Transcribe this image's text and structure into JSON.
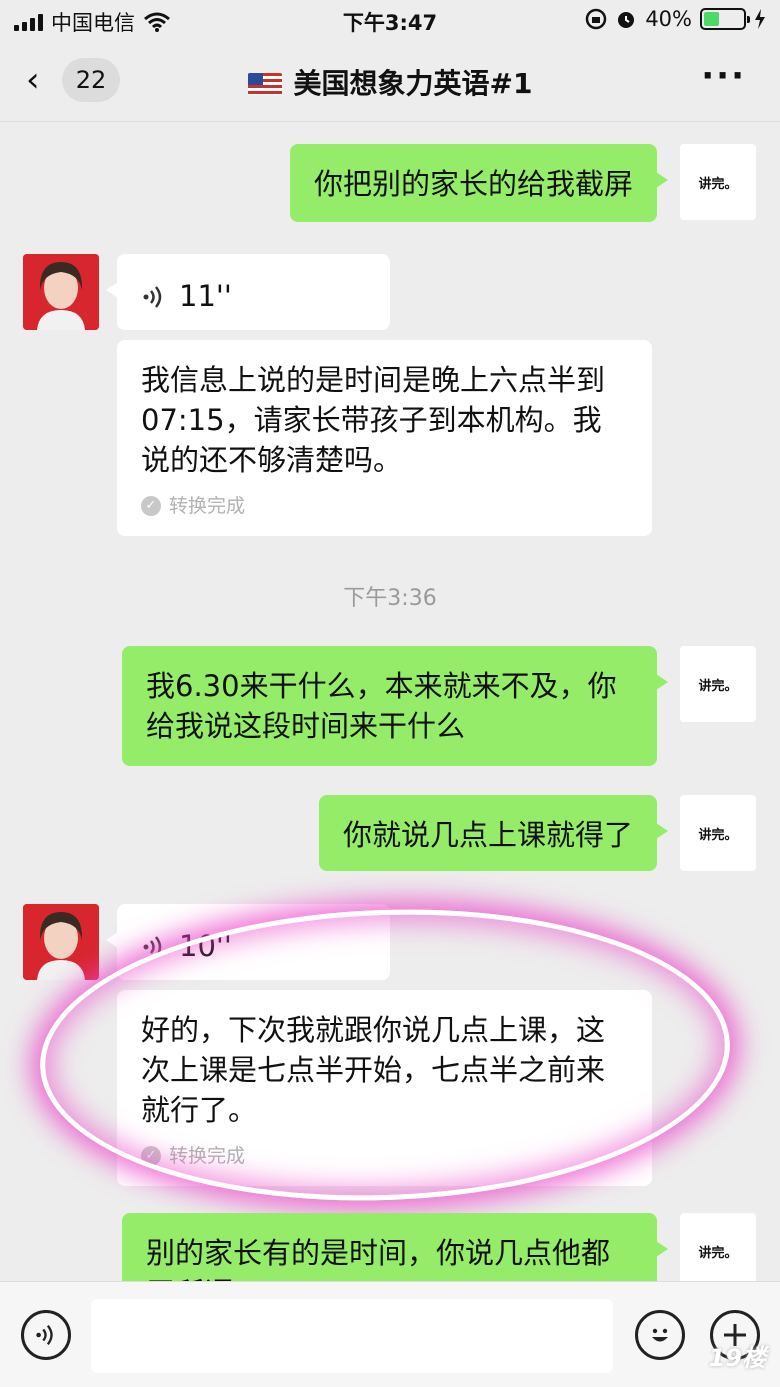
{
  "status_bar": {
    "carrier": "中国电信",
    "time": "下午3:47",
    "battery": "40%",
    "battery_level": 0.4,
    "icons": [
      "signal-icon",
      "wifi-icon",
      "rotation-lock-icon",
      "alarm-icon",
      "battery-icon",
      "charging-icon"
    ]
  },
  "nav": {
    "back_count": "22",
    "title": "美国想象力英语#1",
    "title_icon": "us-flag-icon"
  },
  "my_avatar_text": "讲完。",
  "messages": {
    "m1": {
      "text": "你把别的家长的给我截屏"
    },
    "m2_voice": {
      "duration": "11''"
    },
    "m2_text": {
      "text": "我信息上说的是时间是晚上六点半到07:15，请家长带孩子到本机构。我说的还不够清楚吗。",
      "status": "转换完成"
    },
    "timestamp": "下午3:36",
    "m3": {
      "text": "我6.30来干什么，本来就来不及，你给我说这段时间来干什么"
    },
    "m4": {
      "text": "你就说几点上课就得了"
    },
    "m5_voice": {
      "duration": "10''"
    },
    "m5_text": {
      "text": "好的，下次我就跟你说几点上课，这次上课是七点半开始，七点半之前来就行了。",
      "status": "转换完成"
    },
    "m6": {
      "text": "别的家长有的是时间，你说几点他都无所谓"
    }
  },
  "watermark": "19楼",
  "colors": {
    "outgoing": "#95ec69",
    "incoming": "#ffffff",
    "background": "#ededed",
    "highlight": "#eb46c8"
  }
}
